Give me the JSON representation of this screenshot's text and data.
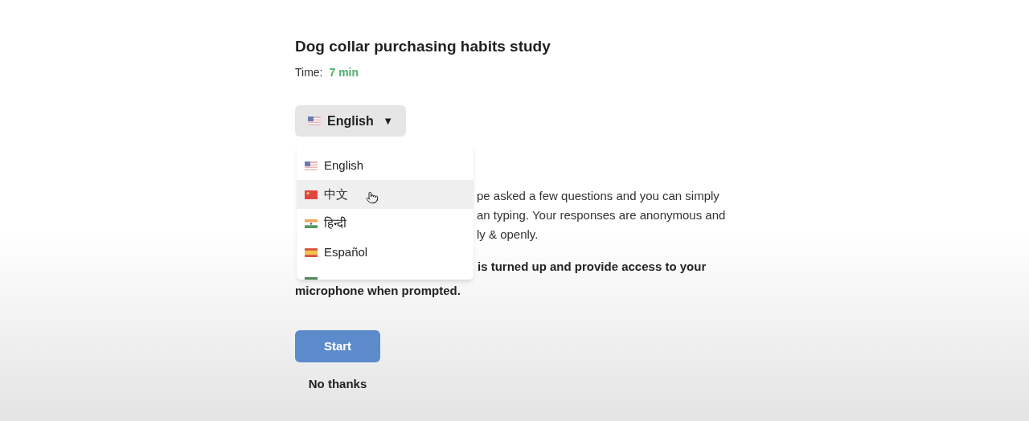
{
  "title": "Dog collar purchasing habits study",
  "time": {
    "label": "Time:",
    "value": "7 min"
  },
  "language_select": {
    "kind": "us",
    "value": "English",
    "caret": "▼"
  },
  "language_menu": [
    {
      "kind": "us",
      "label": "English",
      "highlighted": false
    },
    {
      "kind": "cn",
      "label": "中文",
      "highlighted": true
    },
    {
      "kind": "in",
      "label": "हिन्दी",
      "highlighted": false
    },
    {
      "kind": "es",
      "label": "Español",
      "highlighted": false
    },
    {
      "kind": "sa",
      "highlighted": false
    }
  ],
  "intro_lines": [
    "pe asked a few questions and you can simply",
    "an typing. Your responses are anonymous and",
    "ly & openly."
  ],
  "notice_lines": [
    "is turned up and provide access to your",
    "microphone when prompted."
  ],
  "buttons": {
    "start": "Start",
    "decline": "No thanks"
  }
}
